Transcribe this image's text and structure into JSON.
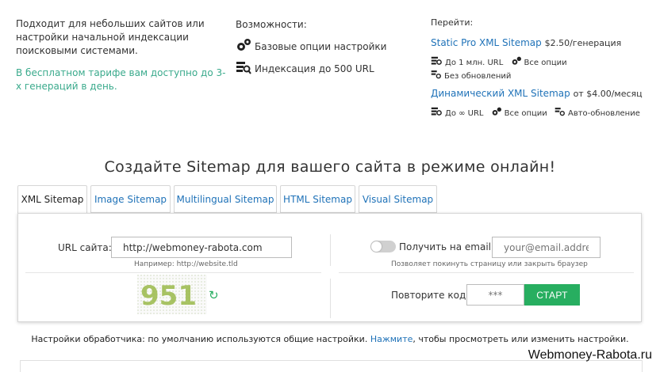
{
  "info": {
    "left_text": "Подходит для небольших сайтов или настройки начальной индексации поисковыми системами.",
    "left_green": "В бесплатном тарифе вам доступно до 3-х генераций в день.",
    "features_title": "Возможности:",
    "features": [
      {
        "label": "Базовые опции настройки",
        "icon": "gears-icon"
      },
      {
        "label": "Индексация до 500 URL",
        "icon": "index-search-icon"
      }
    ],
    "goto_title": "Перейти:",
    "plans": [
      {
        "name": "Static Pro XML Sitemap",
        "price": "$2.50/генерация",
        "features": [
          "До 1 млн. URL",
          "Все опции",
          "Без обновлений"
        ]
      },
      {
        "name": "Динамический XML Sitemap",
        "price": "от $4.00/месяц",
        "features": [
          "До ∞ URL",
          "Все опции",
          "Авто-обновление"
        ]
      }
    ]
  },
  "heading": "Создайте Sitemap для вашего сайта в режиме онлайн!",
  "tabs": [
    {
      "label": "XML Sitemap",
      "active": true
    },
    {
      "label": "Image Sitemap",
      "active": false
    },
    {
      "label": "Multilingual Sitemap",
      "active": false
    },
    {
      "label": "HTML Sitemap",
      "active": false
    },
    {
      "label": "Visual Sitemap",
      "active": false
    }
  ],
  "form": {
    "url_label": "URL сайта:",
    "url_value": "http://webmoney-rabota.com",
    "url_hint": "Например: http://website.tld",
    "email_toggle_label": "Получить на email:",
    "email_placeholder": "your@email.address",
    "email_hint": "Позволяет покинуть страницу или закрыть браузер",
    "captcha_text": "951",
    "repeat_code_label": "Повторите код:",
    "code_placeholder": "***",
    "start_button": "СТАРТ"
  },
  "settings": {
    "prefix": "Настройки обработчика: по умолчанию используются общие настройки.",
    "link": "Нажмите",
    "suffix": ", чтобы просмотреть или изменить настройки."
  },
  "watermark": "Webmoney-Rabota.ru",
  "colors": {
    "accent": "#1f72b8",
    "green_text": "#3aaa8c",
    "start_button": "#27ae60"
  }
}
